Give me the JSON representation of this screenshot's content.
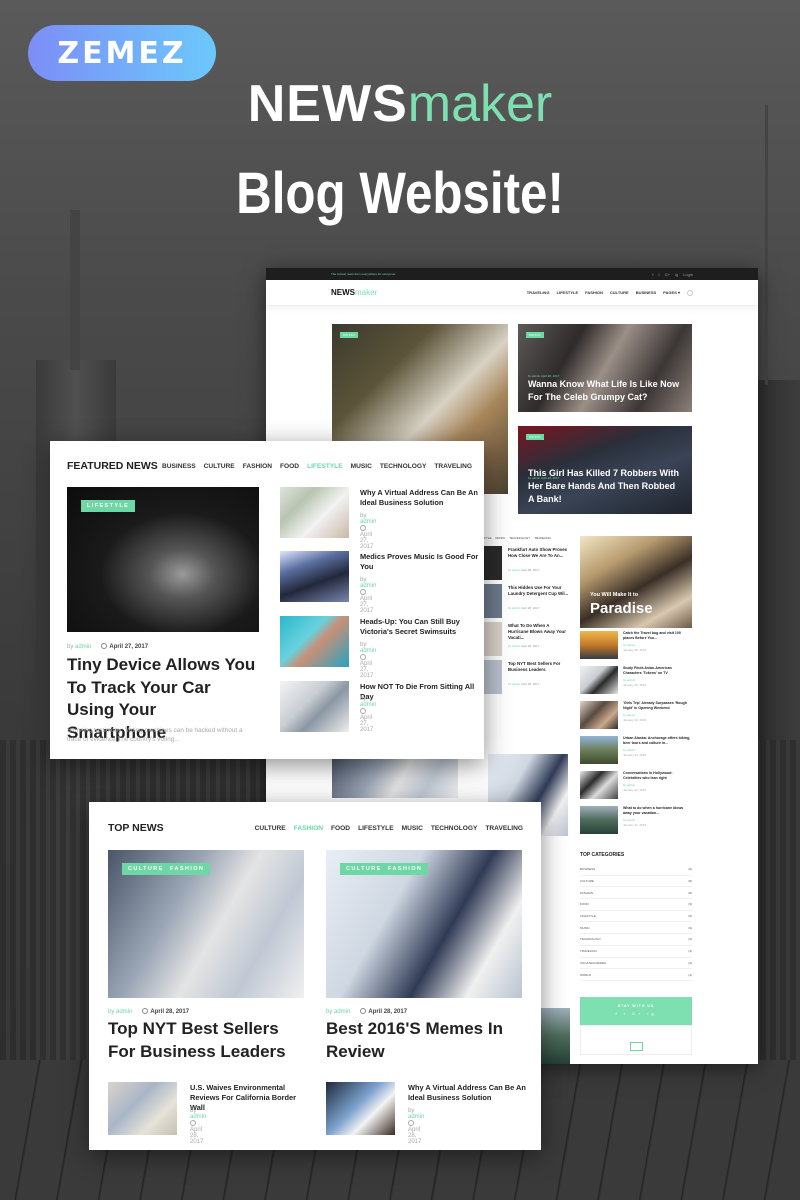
{
  "brand": {
    "badge": "ZEMEZ",
    "title_bold": "NEWS",
    "title_light": "maker",
    "subtitle": "Blog Website!",
    "accent_color": "#6dd7a5"
  },
  "site_preview": {
    "topbar": {
      "tagline": "The hottest news from everywhere for everyone!",
      "social": [
        "f",
        "t",
        "G+",
        "ig"
      ],
      "login": "Login"
    },
    "logo_bold": "NEWS",
    "logo_light": "maker",
    "menu": [
      "TRAVELING",
      "LIFESTYLE",
      "FASHION",
      "CULTURE",
      "BUSINESS",
      "PAGES ▾"
    ],
    "hero": {
      "main_tag": "MUSIC",
      "cards": [
        {
          "tag": "MUSIC",
          "meta": "by admin   April 28, 2017",
          "title": "Wanna Know What Life Is Like Now For The Celeb Grumpy Cat?"
        },
        {
          "tag": "MUSIC",
          "meta": "by admin   April 28, 2017",
          "title": "This Girl Has Killed 7 Robbers With Her Bare Hands And Then Robbed A Bank!"
        }
      ]
    },
    "mid_tabs": [
      "STYLE",
      "MUSIC",
      "TECHNOLOGY",
      "TRAVELING"
    ],
    "mini_list": [
      {
        "title": "Frankfurt Auto Show Proves How Close We Are To An...",
        "by": "by admin",
        "date": "April 28, 2017"
      },
      {
        "title": "This Hidden Use For Your Laundry Detergent Cup Wil...",
        "by": "by admin",
        "date": "April 28, 2017"
      },
      {
        "title": "What To Do When A Hurricane Blows Away Your Vacati...",
        "by": "by admin",
        "date": "April 28, 2017"
      },
      {
        "title": "Top NYT Best Sellers For Business Leaders",
        "by": "by admin",
        "date": "April 28, 2017"
      }
    ],
    "promo": {
      "small": "You Will Make It to",
      "big": "Paradise"
    },
    "side_posts": [
      {
        "title": "Catch the Travel bug and visit 100 places Before You...",
        "by": "by admin",
        "date": "January 26, 2016"
      },
      {
        "title": "Study Finds Asian-American Characters 'Tokens' on TV",
        "by": "by admin",
        "date": "January 25, 2016"
      },
      {
        "title": "'Girls Trip' Already Surpasses 'Rough Night' in Opening Weekend",
        "by": "by admin",
        "date": "January 24, 2016"
      },
      {
        "title": "Urban Alaska: Anchorage offers biking, beer tours and culture in...",
        "by": "by admin",
        "date": "January 23, 2016"
      },
      {
        "title": "Conversations in Hollywood: Celebrities who lean right",
        "by": "by admin",
        "date": "January 22, 2016"
      },
      {
        "title": "What to do when a hurricane blows away your vacation...",
        "by": "by admin",
        "date": "January 21, 2016"
      }
    ],
    "top_categories": {
      "title": "TOP CATEGORIES",
      "items": [
        {
          "name": "BUSINESS",
          "count": "(6)"
        },
        {
          "name": "CULTURE",
          "count": "(8)"
        },
        {
          "name": "FASHION",
          "count": "(8)"
        },
        {
          "name": "FOOD",
          "count": "(3)"
        },
        {
          "name": "LIFESTYLE",
          "count": "(5)"
        },
        {
          "name": "MUSIC",
          "count": "(9)"
        },
        {
          "name": "TECHNOLOGY",
          "count": "(2)"
        },
        {
          "name": "TRAVELING",
          "count": "(3)"
        },
        {
          "name": "UNCATEGORIZED",
          "count": "(4)"
        },
        {
          "name": "WORLD",
          "count": "(4)"
        }
      ]
    },
    "stay": {
      "label": "STAY WITH US",
      "social": "f t G+ ig"
    }
  },
  "featured": {
    "title": "FEATURED NEWS",
    "tabs": [
      "BUSINESS",
      "CULTURE",
      "FASHION",
      "FOOD",
      "LIFESTYLE",
      "MUSIC",
      "TECHNOLOGY",
      "TRAVELING"
    ],
    "active_tab": "LIFESTYLE",
    "main": {
      "tag": "LIFESTYLE",
      "by": "by",
      "author": "admin",
      "date": "April 27, 2017",
      "title": "Tiny Device Allows You To Track Your Car Using Your Smartphone",
      "excerpt": "Stunning testimony: Voting machines can be hacked without a trace of evidence The country's voting..."
    },
    "side": [
      {
        "title": "Why A Virtual Address Can Be An Ideal Business Solution",
        "by": "by",
        "author": "admin",
        "date": "April 27, 2017"
      },
      {
        "title": "Medics Proves Music Is Good For You",
        "by": "by",
        "author": "admin",
        "date": "April 27, 2017"
      },
      {
        "title": "Heads-Up: You Can Still Buy Victoria's Secret Swimsuits",
        "by": "by",
        "author": "admin",
        "date": "April 27, 2017"
      },
      {
        "title": "How NOT To Die From Sitting All Day",
        "by": "by",
        "author": "admin",
        "date": "April 27, 2017"
      }
    ]
  },
  "top_news": {
    "title": "TOP NEWS",
    "tabs": [
      "CULTURE",
      "FASHION",
      "FOOD",
      "LIFESTYLE",
      "MUSIC",
      "TECHNOLOGY",
      "TRAVELING"
    ],
    "active_tab": "FASHION",
    "main": [
      {
        "tags": [
          "CULTURE",
          "FASHION"
        ],
        "by": "by admin",
        "date": "April 28, 2017",
        "title": "Top NYT Best Sellers For Business Leaders"
      },
      {
        "tags": [
          "CULTURE",
          "FASHION"
        ],
        "by": "by admin",
        "date": "April 28, 2017",
        "title": "Best 2016'S Memes In Review"
      }
    ],
    "small": [
      {
        "title": "U.S. Waives Environmental Reviews For California Border Wall",
        "by": "by",
        "author": "admin",
        "date": "April 28, 2017"
      },
      {
        "title": "Why A Virtual Address Can Be An Ideal Business Solution",
        "by": "by",
        "author": "admin",
        "date": "April 28, 2017"
      }
    ]
  }
}
